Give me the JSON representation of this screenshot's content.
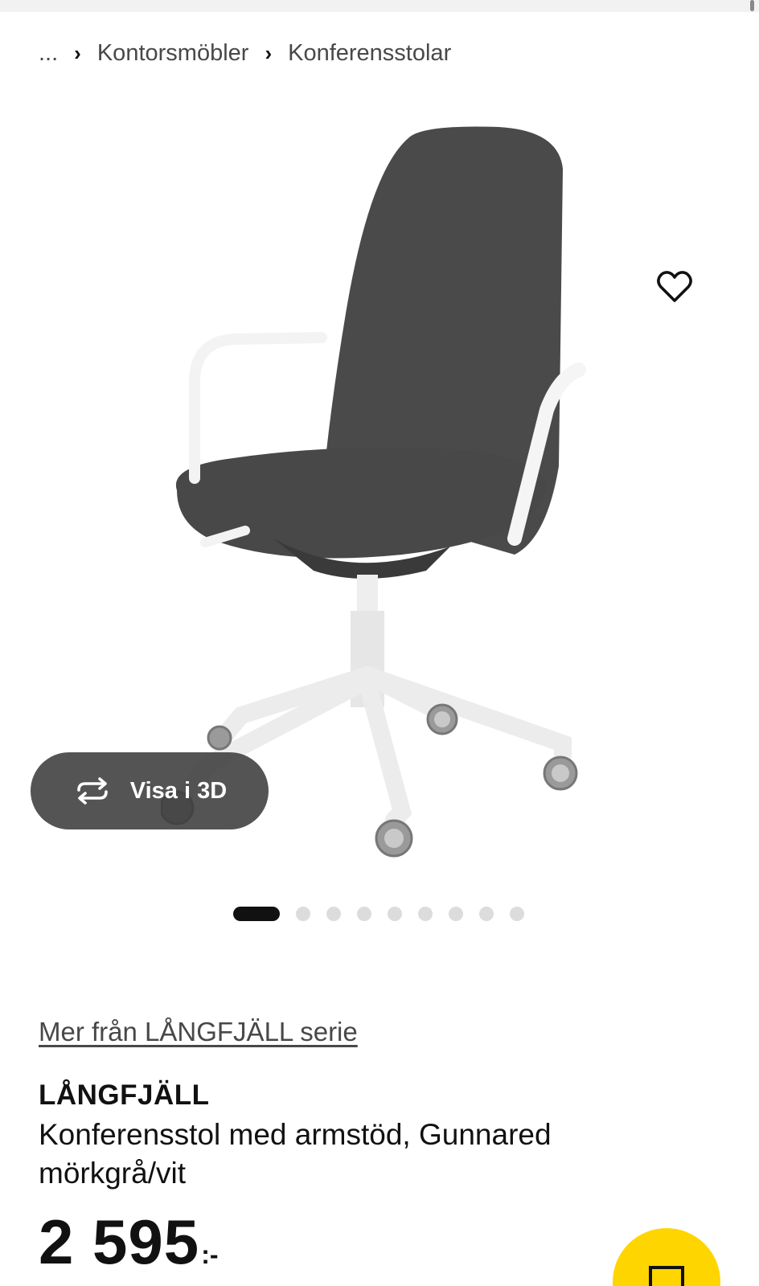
{
  "breadcrumb": {
    "ellipsis": "...",
    "items": [
      {
        "label": "Kontorsmöbler"
      },
      {
        "label": "Konferensstolar"
      }
    ]
  },
  "gallery": {
    "view3d_label": "Visa i 3D",
    "dot_count": 9,
    "active_dot": 1
  },
  "product": {
    "series_link": "Mer från LÅNGFJÄLL serie",
    "name": "LÅNGFJÄLL",
    "description": "Konferensstol med armstöd, Gunnared mörkgrå/vit",
    "price": "2 595",
    "price_suffix": ":-"
  },
  "colors": {
    "accent_yellow": "#ffd500",
    "text_dark": "#111111",
    "text_muted": "#484848",
    "dot_inactive": "#dcdcdc"
  }
}
